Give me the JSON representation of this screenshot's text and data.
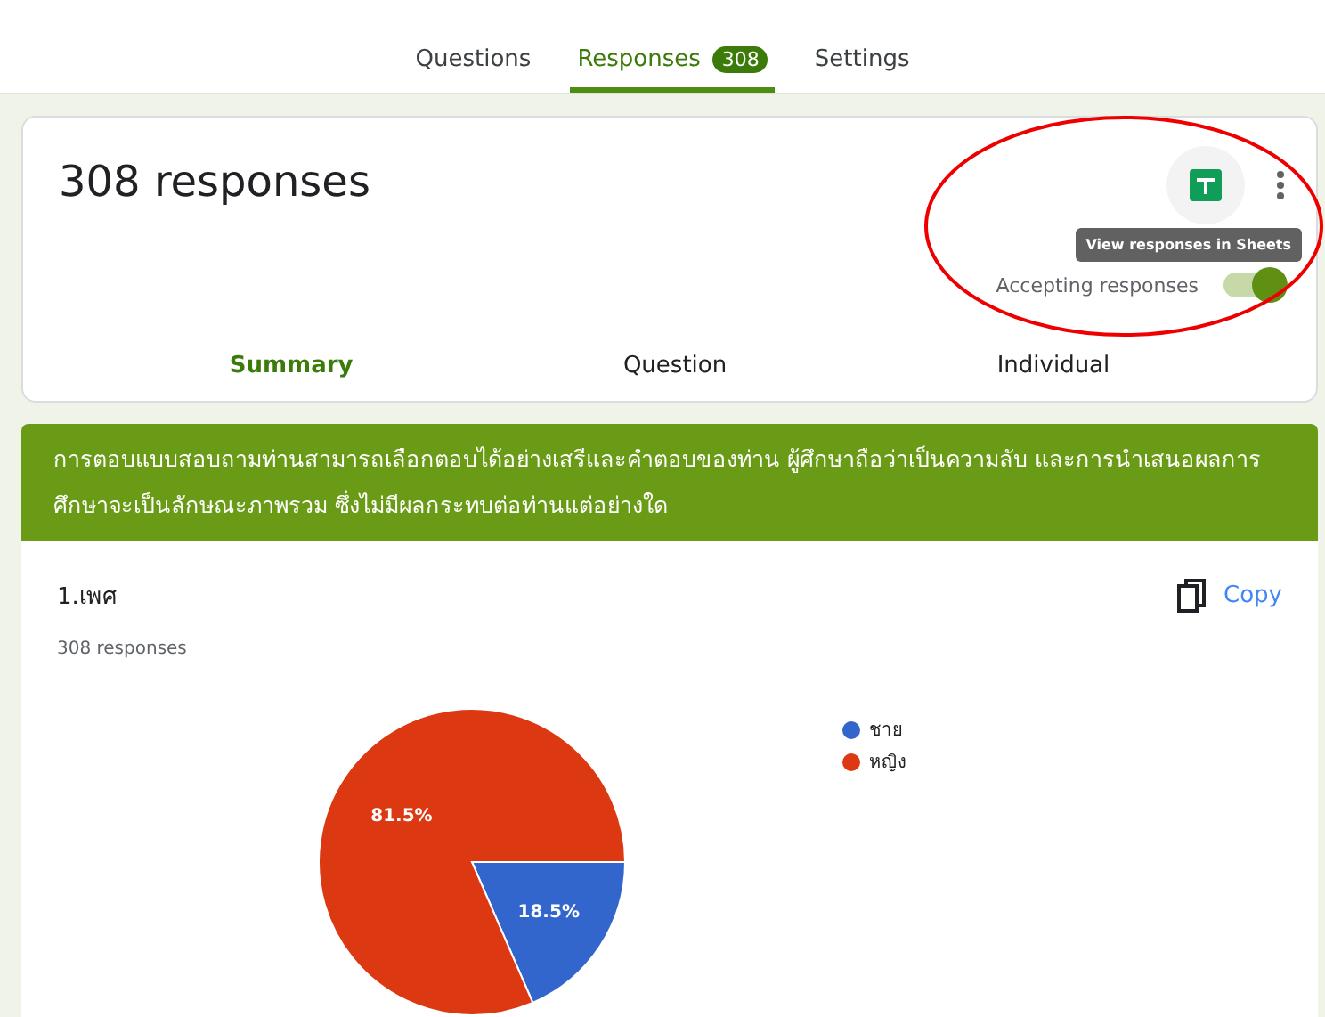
{
  "top_tabs": [
    {
      "label": "Questions",
      "selected": false
    },
    {
      "label": "Responses",
      "selected": true,
      "badge": "308"
    },
    {
      "label": "Settings",
      "selected": false
    }
  ],
  "header": {
    "title": "308 responses",
    "tooltip": "View responses in Sheets",
    "accepting_label": "Accepting responses",
    "accepting_on": true
  },
  "view_tabs": [
    {
      "label": "Summary",
      "selected": true
    },
    {
      "label": "Question",
      "selected": false
    },
    {
      "label": "Individual",
      "selected": false
    }
  ],
  "banner": "การตอบแบบสอบถามท่านสามารถเลือกตอบได้อย่างเสรีและคำตอบของท่าน ผู้ศึกษาถือว่าเป็นความลับ และการนำเสนอผลการศึกษาจะเป็นลักษณะภาพรวม ซึ่งไม่มีผลกระทบต่อท่านแต่อย่างใด",
  "question": {
    "title": "1.เพศ",
    "count": "308 responses",
    "copy_label": "Copy",
    "chart_data": {
      "type": "pie",
      "categories": [
        "ชาย",
        "หญิง"
      ],
      "values": [
        18.5,
        81.5
      ],
      "data_labels": true,
      "legend": true,
      "colors": [
        "#3366cc",
        "#dc3912"
      ],
      "value_labels": [
        "18.5%",
        "81.5%"
      ]
    }
  }
}
